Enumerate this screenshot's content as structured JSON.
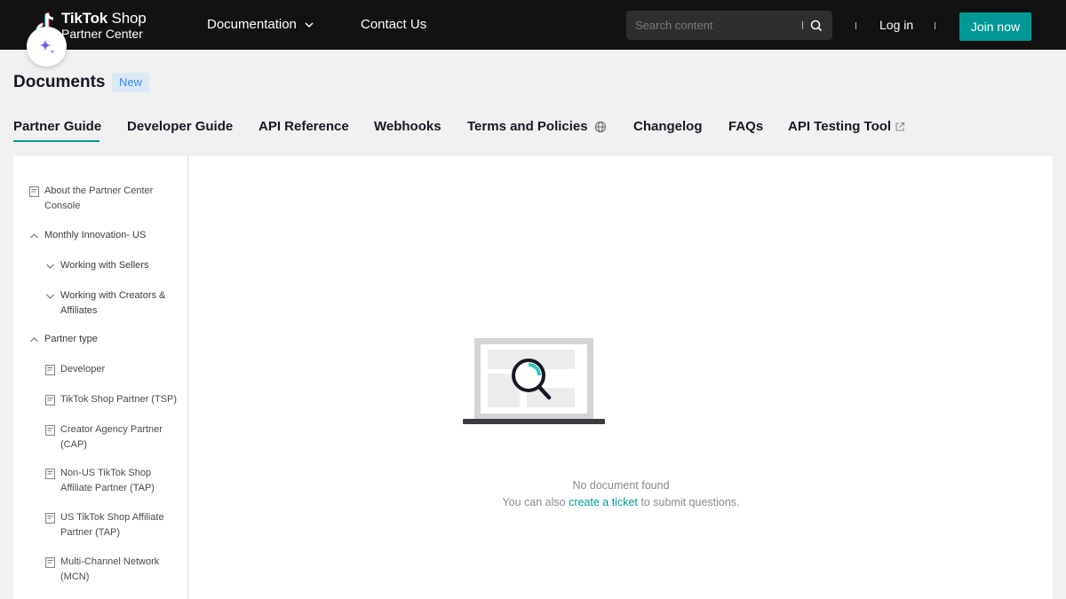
{
  "header": {
    "logo_line1_brand": "TikTok",
    "logo_line1_shop": " Shop",
    "logo_line2": "Partner Center",
    "nav": [
      {
        "label": "Documentation"
      },
      {
        "label": "Contact Us"
      }
    ],
    "search_placeholder": "Search content",
    "login_label": "Log in",
    "join_label": "Join now"
  },
  "page": {
    "title": "Documents",
    "badge": "New"
  },
  "tabs": [
    {
      "label": "Partner Guide",
      "active": true
    },
    {
      "label": "Developer Guide"
    },
    {
      "label": "API Reference"
    },
    {
      "label": "Webhooks"
    },
    {
      "label": "Terms and Policies",
      "icon": "globe-icon"
    },
    {
      "label": "Changelog"
    },
    {
      "label": "FAQs"
    },
    {
      "label": "API Testing Tool",
      "icon": "external-link-icon"
    }
  ],
  "sidebar": {
    "items": [
      {
        "lines": [
          "About the Partner Center",
          "Console"
        ],
        "icon": "document-icon"
      },
      {
        "lines": [
          "Monthly Innovation- US"
        ],
        "icon": "chevron-up-icon"
      },
      {
        "lines": [
          "Working with Sellers"
        ],
        "icon": "chevron-down-icon"
      },
      {
        "lines": [
          "Working with Creators &",
          "Affiliates"
        ],
        "icon": "chevron-down-icon"
      },
      {
        "lines": [
          "Partner type"
        ],
        "icon": "chevron-up-icon"
      },
      {
        "lines": [
          "Developer"
        ],
        "icon": "document-icon"
      },
      {
        "lines": [
          "TikTok Shop Partner (TSP)"
        ],
        "icon": "document-icon"
      },
      {
        "lines": [
          "Creator Agency Partner",
          "(CAP)"
        ],
        "icon": "document-icon"
      },
      {
        "lines": [
          "Non-US TikTok Shop",
          "Affiliate Partner (TAP)"
        ],
        "icon": "document-icon"
      },
      {
        "lines": [
          "US TikTok Shop Affiliate",
          "Partner (TAP)"
        ],
        "icon": "document-icon"
      },
      {
        "lines": [
          "Multi-Channel Network",
          "(MCN)"
        ],
        "icon": "document-icon"
      }
    ]
  },
  "empty_state": {
    "title": "No document found",
    "sub_before": "You can also ",
    "link": "create a ticket",
    "sub_after": " to submit questions."
  },
  "colors": {
    "accent": "#009995",
    "topbar": "#121212",
    "badge_bg": "#dde8f7",
    "badge_text": "#3a8af0"
  }
}
